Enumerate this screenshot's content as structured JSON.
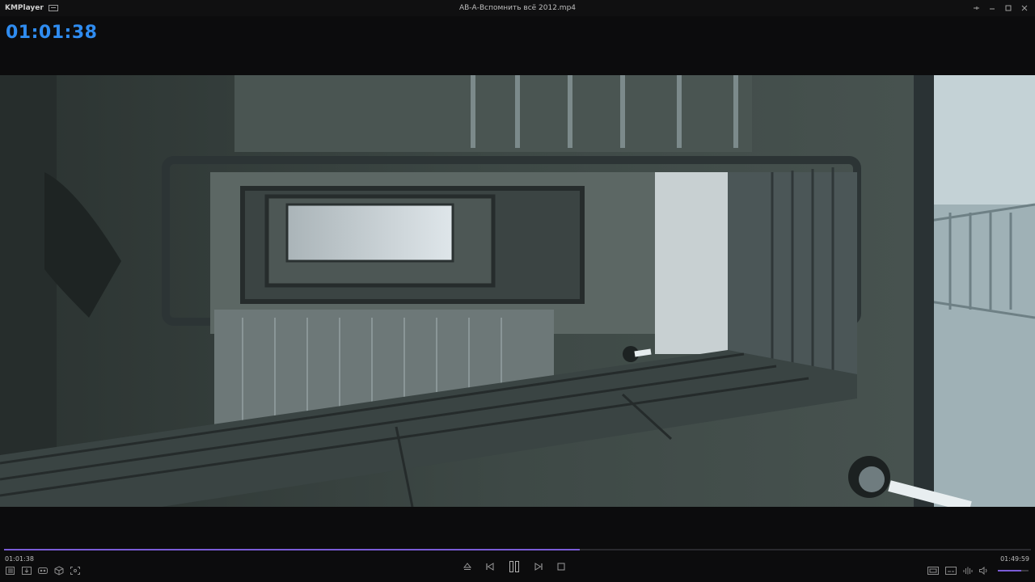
{
  "app": {
    "name": "KMPlayer",
    "file_title": "АВ-А-Вспомнить всё 2012.mp4"
  },
  "overlay": {
    "current_time": "01:01:38"
  },
  "playback": {
    "current_time": "01:01:38",
    "total_time": "01:49:59",
    "progress_fraction": 0.561,
    "volume_fraction": 0.75
  },
  "colors": {
    "accent": "#7a5cd6",
    "time_overlay": "#2f8cf0"
  },
  "icons": {
    "title_left": [
      "menu-icon"
    ],
    "window": [
      "pin-icon",
      "minimize-icon",
      "maximize-icon",
      "close-icon"
    ],
    "left_controls": [
      "playlist-icon",
      "download-icon",
      "vr-icon",
      "3d-icon",
      "capture-icon"
    ],
    "center_controls": [
      "eject-icon",
      "previous-icon",
      "pause-icon",
      "next-icon",
      "stop-icon"
    ],
    "right_controls": [
      "screen-mode-icon",
      "subtitle-icon",
      "equalizer-icon",
      "volume-icon"
    ]
  }
}
